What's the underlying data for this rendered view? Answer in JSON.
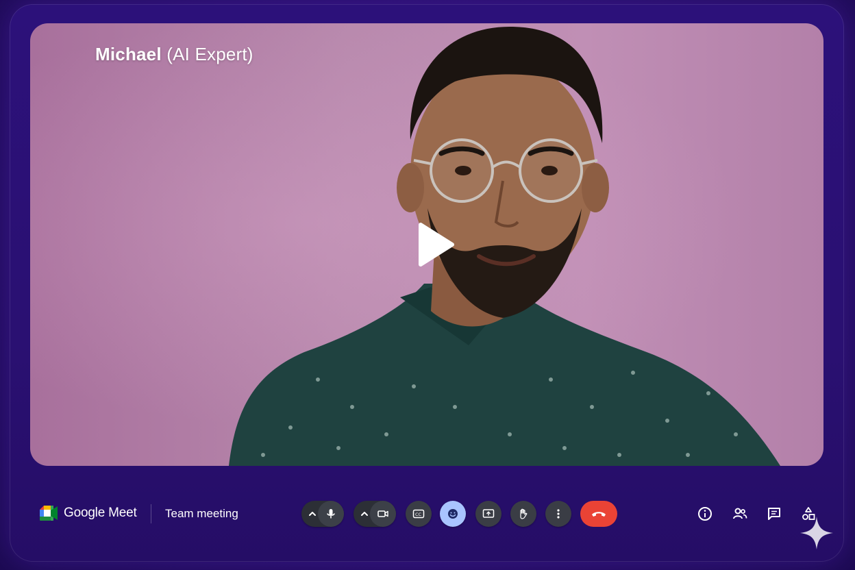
{
  "participant": {
    "name": "Michael",
    "role": "(AI Expert)"
  },
  "app": {
    "name": "Google Meet"
  },
  "meeting": {
    "title": "Team meeting"
  },
  "controls": [
    {
      "name": "microphone",
      "icon": "mic-icon"
    },
    {
      "name": "camera",
      "icon": "video-camera-icon"
    },
    {
      "name": "captions",
      "icon": "closed-captions-icon"
    },
    {
      "name": "reactions",
      "icon": "emoji-icon",
      "active": true
    },
    {
      "name": "present",
      "icon": "present-screen-icon"
    },
    {
      "name": "raise-hand",
      "icon": "hand-icon"
    },
    {
      "name": "more-options",
      "icon": "more-vert-icon"
    },
    {
      "name": "leave-call",
      "icon": "call-end-icon"
    }
  ],
  "side_controls": [
    {
      "name": "meeting-info",
      "icon": "info-icon"
    },
    {
      "name": "people",
      "icon": "people-icon"
    },
    {
      "name": "chat",
      "icon": "chat-icon"
    },
    {
      "name": "activities",
      "icon": "shapes-icon"
    }
  ],
  "colors": {
    "background": "#2a1072",
    "video_bg": "#b889ad",
    "end_call": "#ea4335",
    "active_control": "#a9c4ff",
    "control_bg": "#3a3d45"
  }
}
